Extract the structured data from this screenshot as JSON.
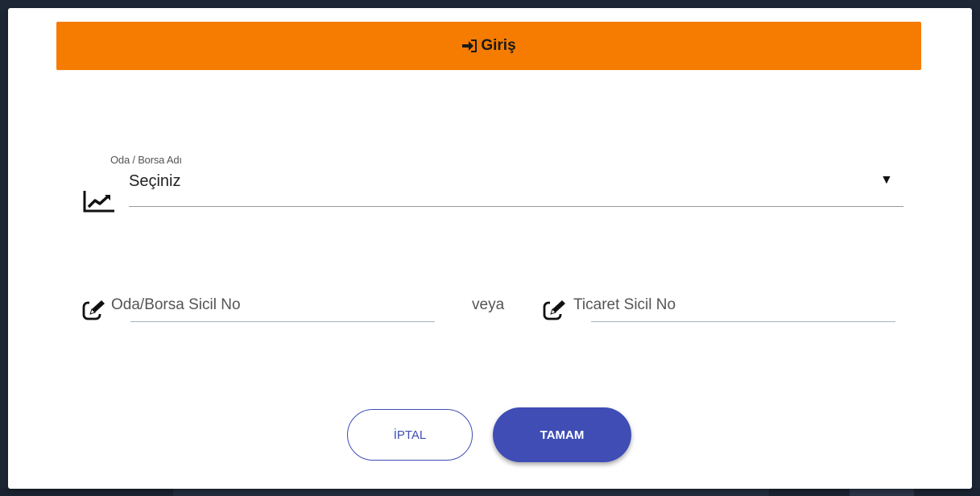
{
  "header": {
    "title": "Giriş",
    "icon": "sign-in-icon",
    "color": "#f57c00"
  },
  "chamber_select": {
    "label": "Oda / Borsa Adı",
    "selected_value": "Seçiniz",
    "arrow": "▼",
    "icon": "chart-line-icon"
  },
  "chamber_registry": {
    "placeholder": "Oda/Borsa Sicil No",
    "value": "",
    "icon": "edit-icon"
  },
  "separator": "veya",
  "trade_registry": {
    "placeholder": "Ticaret Sicil No",
    "value": "",
    "icon": "edit-icon"
  },
  "buttons": {
    "cancel_label": "İPTAL",
    "ok_label": "TAMAM",
    "primary_color": "#3f4db5"
  }
}
